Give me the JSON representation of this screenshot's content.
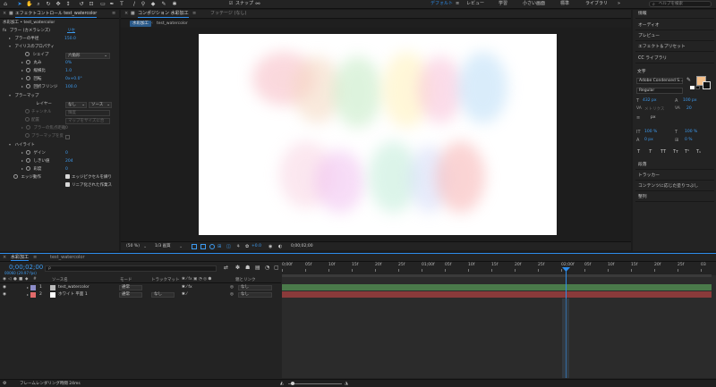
{
  "toolbar": {
    "snapping_label": "スナップ",
    "workspaces": [
      "デフォルト",
      "レビュー",
      "学習",
      "小さい画面",
      "標準",
      "ライブラリ"
    ],
    "search_placeholder": "ヘルプを検索"
  },
  "effects_panel": {
    "tab_label": "エフェクトコントロール test_watercolor",
    "breadcrumb": "水彩加工 • test_watercolor",
    "effect_name": "ブラー (カメラレンズ)",
    "effect_reset": "リセ",
    "blur_radius_label": "ブラーの半径",
    "blur_radius_value": "150.0",
    "iris_label": "アイリスのプロパティ",
    "shape_label": "シェイプ",
    "shape_value": "六角形",
    "roundness_label": "丸み",
    "roundness_value": "0%",
    "aspect_label": "縦横比",
    "aspect_value": "1.0",
    "rotation_label": "回転",
    "rotation_value": "0x+0.0°",
    "diffraction_label": "回折フリンジ",
    "diffraction_value": "100.0",
    "blurmap_label": "ブラーマップ",
    "layer_label": "レイヤー",
    "layer_value": "なし",
    "source_value": "ソース",
    "channel_label": "チャンネル",
    "channel_value": "輝度",
    "placement_label": "配置",
    "placement_value": "マップをサイズに合",
    "focal_label": "ブラーの焦点距離",
    "focal_value": "0",
    "invert_label": "ブラーマップを反",
    "highlight_label": "ハイライト",
    "gain_label": "ゲイン",
    "gain_value": "0",
    "threshold_label": "しきい値",
    "threshold_value": "204",
    "saturation_label": "彩度",
    "saturation_value": "0",
    "edge_label": "エッジ動作",
    "edge_option": "エッジピクセルを繰り",
    "linear_option": "リニア化された作業ス"
  },
  "comp_panel": {
    "tab_label": "コンポジション 水彩加工",
    "footage_tab": "フッテージ (なし)",
    "sub_tabs": [
      "水彩加工",
      "test_watercolor"
    ],
    "zoom": "(50 %)",
    "resolution": "1/3 画質",
    "exposure": "+0.0",
    "timecode": "0;00;02;00"
  },
  "right_panel": {
    "items": [
      "情報",
      "オーディオ",
      "プレビュー",
      "エフェクト＆プリセット",
      "CC ライブラリ"
    ],
    "character_title": "文字",
    "font_name": "Adobe Condensed S...",
    "font_style": "Regular",
    "font_size": "432 px",
    "leading": "100 px",
    "kerning": "メトリクス",
    "tracking": "20",
    "stroke": "px",
    "vscale": "100 %",
    "hscale": "100 %",
    "baseline": "0 px",
    "tsume": "0 %",
    "style_buttons": [
      "T",
      "T",
      "TT",
      "Tт",
      "T¹",
      "T₁"
    ],
    "lower_items": [
      "段落",
      "トラッカー",
      "コンテンツに応じた塗りつぶし",
      "整列"
    ]
  },
  "timeline": {
    "tab_label": "水彩加工",
    "tab2_label": "test_watercolor",
    "timecode": "0;00;02;00",
    "fps": "00060 (29.97 fps)",
    "search_placeholder": "ρ",
    "headers": [
      "ソース名",
      "モード",
      "トラックマット",
      "親とリンク"
    ],
    "layers": [
      {
        "num": "1",
        "name": "test_watercolor",
        "mode": "通常",
        "matte": "",
        "parent": "なし",
        "color": "#8c8cc8"
      },
      {
        "num": "2",
        "name": "ホワイト 平面 1",
        "mode": "通常",
        "matte": "なし",
        "parent": "なし",
        "color": "#e0e0e0"
      }
    ],
    "ruler_labels": [
      "0;00f",
      "05f",
      "10f",
      "15f",
      "20f",
      "25f",
      "01;00f",
      "05f",
      "10f",
      "15f",
      "20f",
      "25f",
      "02;00f",
      "05f",
      "10f",
      "15f",
      "20f",
      "25f",
      "03"
    ],
    "status": "フレームレンダリング時間 24ms"
  }
}
